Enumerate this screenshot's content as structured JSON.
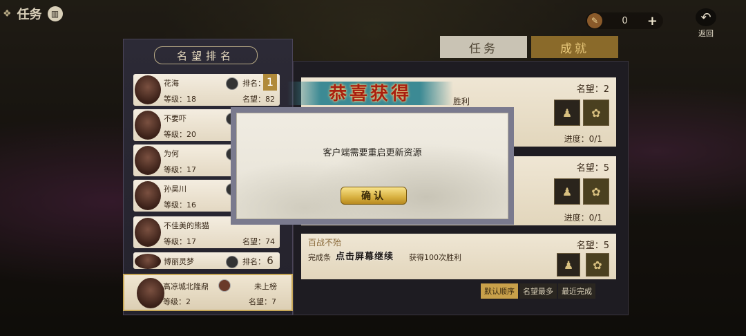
{
  "header": {
    "title": "任务",
    "currency_value": "0",
    "back_label": "返回"
  },
  "tabs": [
    {
      "label": "任务",
      "active": false
    },
    {
      "label": "成就",
      "active": true
    }
  ],
  "ranking": {
    "title": "名望排名",
    "rows": [
      {
        "name": "花海",
        "level": "等级：18",
        "rank_label": "排名：",
        "rank": "1",
        "fame": "名望：82"
      },
      {
        "name": "不要吓",
        "level": "等级：20",
        "rank_label": "",
        "rank": "",
        "fame": ""
      },
      {
        "name": "为何",
        "level": "等级：17",
        "rank_label": "",
        "rank": "",
        "fame": ""
      },
      {
        "name": "孙昊川",
        "level": "等级：16",
        "rank_label": "",
        "rank": "",
        "fame": ""
      },
      {
        "name": "不佳美的熊猫",
        "level": "等级：17",
        "rank_label": "",
        "rank": "",
        "fame": "名望：74"
      },
      {
        "name": "博丽灵梦",
        "level": "",
        "rank_label": "排名：",
        "rank": "6",
        "fame": ""
      }
    ],
    "me": {
      "name": "高凉城北隆鼎",
      "level": "等级：2",
      "rank_label": "未上榜",
      "fame": "名望：7"
    }
  },
  "achievements": [
    {
      "title": "",
      "fame": "名望：2",
      "desc": "",
      "progress": "进度：0/1"
    },
    {
      "title": "",
      "fame": "名望：5",
      "desc": "",
      "progress": "进度：0/1"
    },
    {
      "title": "百战不殆",
      "fame": "名望：5",
      "desc": "完成条",
      "progress": ""
    }
  ],
  "achievement_tail": "获得100次胜利",
  "sort_options": [
    "默认顺序",
    "名望最多",
    "最近完成"
  ],
  "congrats_text": "恭喜获得",
  "congrats_tail": "胜利",
  "tap_hint": "点击屏幕继续",
  "dialog": {
    "message": "客户端需要重启更新资源",
    "confirm_label": "确认"
  }
}
